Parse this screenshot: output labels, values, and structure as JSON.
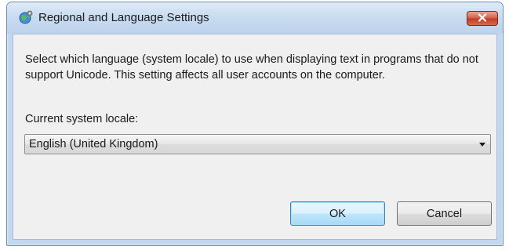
{
  "window": {
    "title": "Regional and Language Settings",
    "icon": "globe-settings-icon",
    "close_icon": "close-x-icon"
  },
  "content": {
    "description": "Select which language (system locale) to use when displaying text in programs that do not support Unicode. This setting affects all user accounts on the computer.",
    "locale_label": "Current system locale:",
    "locale_value": "English (United Kingdom)"
  },
  "buttons": {
    "ok_label": "OK",
    "cancel_label": "Cancel"
  },
  "colors": {
    "title_bar": "#c9dcf1",
    "close_button": "#c23a22",
    "default_button_border": "#3c7fb1",
    "dialog_background": "#f0f0f0"
  }
}
